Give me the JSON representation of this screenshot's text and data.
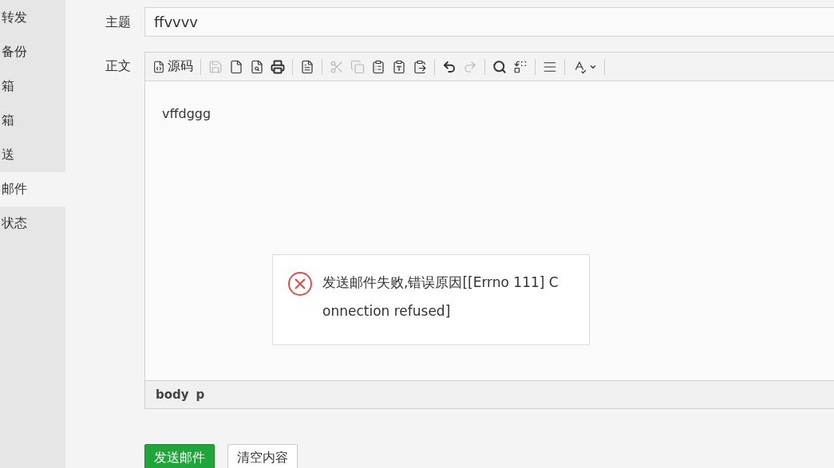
{
  "sidebar": {
    "items": [
      {
        "label": "转发",
        "selected": false
      },
      {
        "label": "备份",
        "selected": false
      },
      {
        "label": "箱",
        "selected": false
      },
      {
        "label": "箱",
        "selected": false
      },
      {
        "label": "送",
        "selected": false
      },
      {
        "label": "邮件",
        "selected": true
      },
      {
        "label": "状态",
        "selected": false
      }
    ]
  },
  "form": {
    "subject_label": "主题",
    "subject_value": "ffvvvv",
    "body_label": "正文"
  },
  "editor": {
    "toolbar": [
      {
        "kind": "source",
        "label": "源码",
        "disabled": false
      },
      {
        "kind": "sep"
      },
      {
        "kind": "save",
        "disabled": true
      },
      {
        "kind": "new",
        "disabled": false
      },
      {
        "kind": "preview",
        "disabled": false
      },
      {
        "kind": "print",
        "disabled": false
      },
      {
        "kind": "sep"
      },
      {
        "kind": "template",
        "disabled": false
      },
      {
        "kind": "sep"
      },
      {
        "kind": "cut",
        "disabled": true
      },
      {
        "kind": "copy",
        "disabled": true
      },
      {
        "kind": "paste",
        "disabled": false
      },
      {
        "kind": "paste-text",
        "disabled": false
      },
      {
        "kind": "paste-word",
        "disabled": false
      },
      {
        "kind": "sep"
      },
      {
        "kind": "undo",
        "disabled": false
      },
      {
        "kind": "redo",
        "disabled": true
      },
      {
        "kind": "sep"
      },
      {
        "kind": "find",
        "disabled": false
      },
      {
        "kind": "replace",
        "disabled": false
      },
      {
        "kind": "sep"
      },
      {
        "kind": "blocks",
        "disabled": false
      },
      {
        "kind": "sep"
      },
      {
        "kind": "spell",
        "disabled": false
      },
      {
        "kind": "sep"
      }
    ],
    "content": "vffdggg",
    "path": [
      "body",
      "p"
    ]
  },
  "buttons": [
    {
      "label": "发送邮件",
      "kind": "primary"
    },
    {
      "label": "清空内容",
      "kind": "default"
    }
  ],
  "dialog": {
    "message": "发送邮件失败,错误原因[[Errno 111] Connection refused]"
  }
}
